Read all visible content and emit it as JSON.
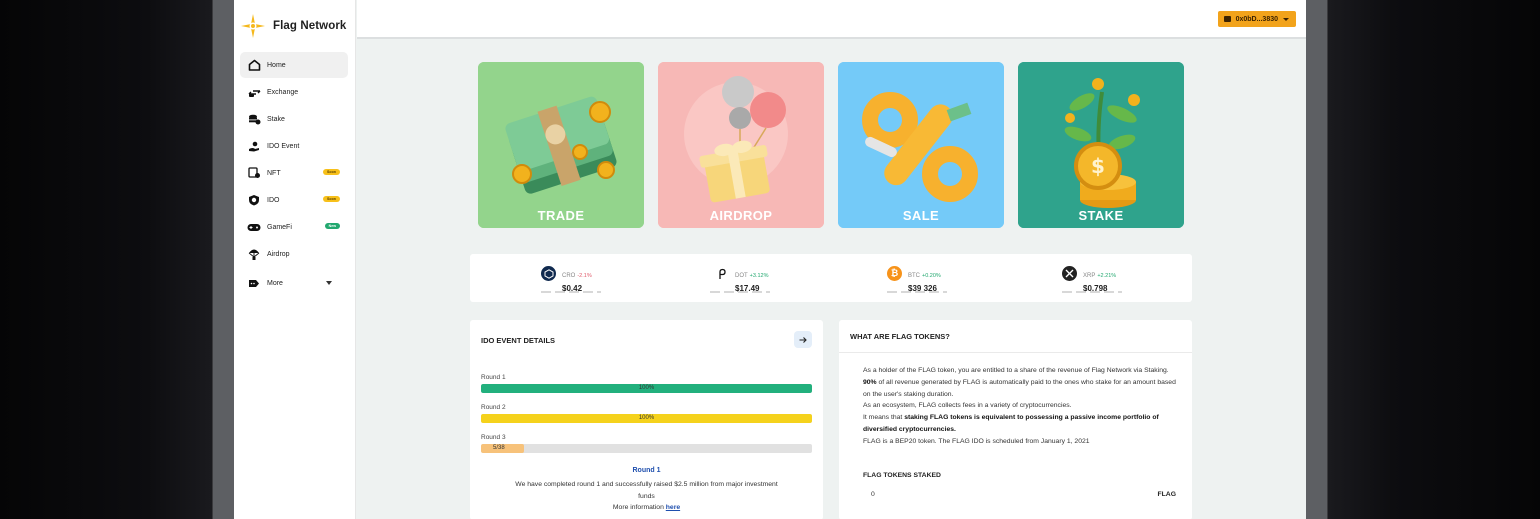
{
  "brand": {
    "name": "Flag Network",
    "logo_icon": "star-compass-icon"
  },
  "sidebar": {
    "items": [
      {
        "label": "Home",
        "icon": "home-icon",
        "active": true,
        "badge": null
      },
      {
        "label": "Exchange",
        "icon": "exchange-icon",
        "badge": null
      },
      {
        "label": "Stake",
        "icon": "coins-stack-icon",
        "badge": null
      },
      {
        "label": "IDO Event",
        "icon": "hand-coin-icon",
        "badge": null
      },
      {
        "label": "NFT",
        "icon": "nft-icon",
        "badge": "Soon"
      },
      {
        "label": "IDO",
        "icon": "shield-coin-icon",
        "badge": "Soon"
      },
      {
        "label": "GameFi",
        "icon": "gamepad-icon",
        "badge": "New"
      },
      {
        "label": "Airdrop",
        "icon": "parachute-icon",
        "badge": null
      },
      {
        "label": "More",
        "icon": "more-tag-icon",
        "badge": null,
        "has_caret": true
      }
    ]
  },
  "topbar": {
    "wallet_label": "0x0bD...3830",
    "wallet_color": "#F2A31B"
  },
  "cards": [
    {
      "label": "TRADE",
      "color": "#8fd28a",
      "art": "cash-stack-coins"
    },
    {
      "label": "AIRDROP",
      "color": "#f7b6b4",
      "art": "balloons-gift"
    },
    {
      "label": "SALE",
      "color": "#6ec8f7",
      "art": "percent-sign"
    },
    {
      "label": "STAKE",
      "color": "#2fa18c",
      "art": "coin-plant"
    }
  ],
  "ticker": [
    {
      "symbol": "CRO",
      "change": "-2.1%",
      "direction": "down",
      "price": "$0.42",
      "icon": "cro-icon"
    },
    {
      "symbol": "DOT",
      "change": "+3.12%",
      "direction": "up",
      "price": "$17.49",
      "icon": "dot-icon"
    },
    {
      "symbol": "BTC",
      "change": "+0.20%",
      "direction": "up",
      "price": "$39 326",
      "icon": "btc-icon"
    },
    {
      "symbol": "XRP",
      "change": "+2.21%",
      "direction": "up",
      "price": "$0.798",
      "icon": "xrp-icon"
    }
  ],
  "ido": {
    "title": "IDO EVENT DETAILS",
    "rounds": [
      {
        "label": "Round 1",
        "progress": 1.0,
        "text": "100%",
        "color": "#22b07d"
      },
      {
        "label": "Round 2",
        "progress": 1.0,
        "text": "100%",
        "color": "#f5d21c"
      },
      {
        "label": "Round 3",
        "progress": 0.13,
        "text": "5/38",
        "color": "#f7c27a"
      }
    ],
    "current_round": "Round 1",
    "description": "We have completed round 1 and successfully raised $2.5 million from major investment funds",
    "more_prefix": "More information",
    "more_link": "here"
  },
  "flag": {
    "title": "WHAT ARE FLAG TOKENS?",
    "p1": "As a holder of the FLAG token, you are entitled to a share of the revenue of Flag Network via Staking.",
    "p2_bold": "90%",
    "p2_rest": " of all revenue generated by FLAG is automatically paid to the ones who stake for an amount based on the user's staking duration.",
    "p3": "As an ecosystem, FLAG collects fees in a variety of cryptocurrencies.",
    "p4_prefix": "It means that ",
    "p4_bold": "staking FLAG tokens is equivalent to possessing a passive income portfolio of diversified cryptocurrencies.",
    "p5": "FLAG is a BEP20 token. The FLAG IDO is scheduled from January 1, 2021",
    "staked_title": "FLAG TOKENS STAKED",
    "staked_value": "0",
    "staked_unit": "FLAG"
  }
}
